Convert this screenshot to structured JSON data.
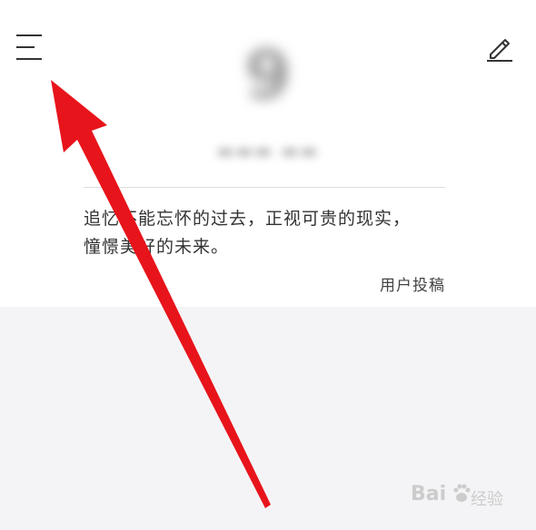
{
  "header": {
    "menu_icon": "hamburger-menu-icon",
    "edit_icon": "pencil-edit-icon"
  },
  "card": {
    "quote_line1": "追忆不能忘怀的过去，正视可贵的现实，",
    "quote_line2": "憧憬美好的未来。",
    "source": "用户投稿"
  },
  "watermark": {
    "brand": "Bai",
    "suffix": "经验"
  },
  "annotation": {
    "arrow_color": "#e8141b"
  }
}
